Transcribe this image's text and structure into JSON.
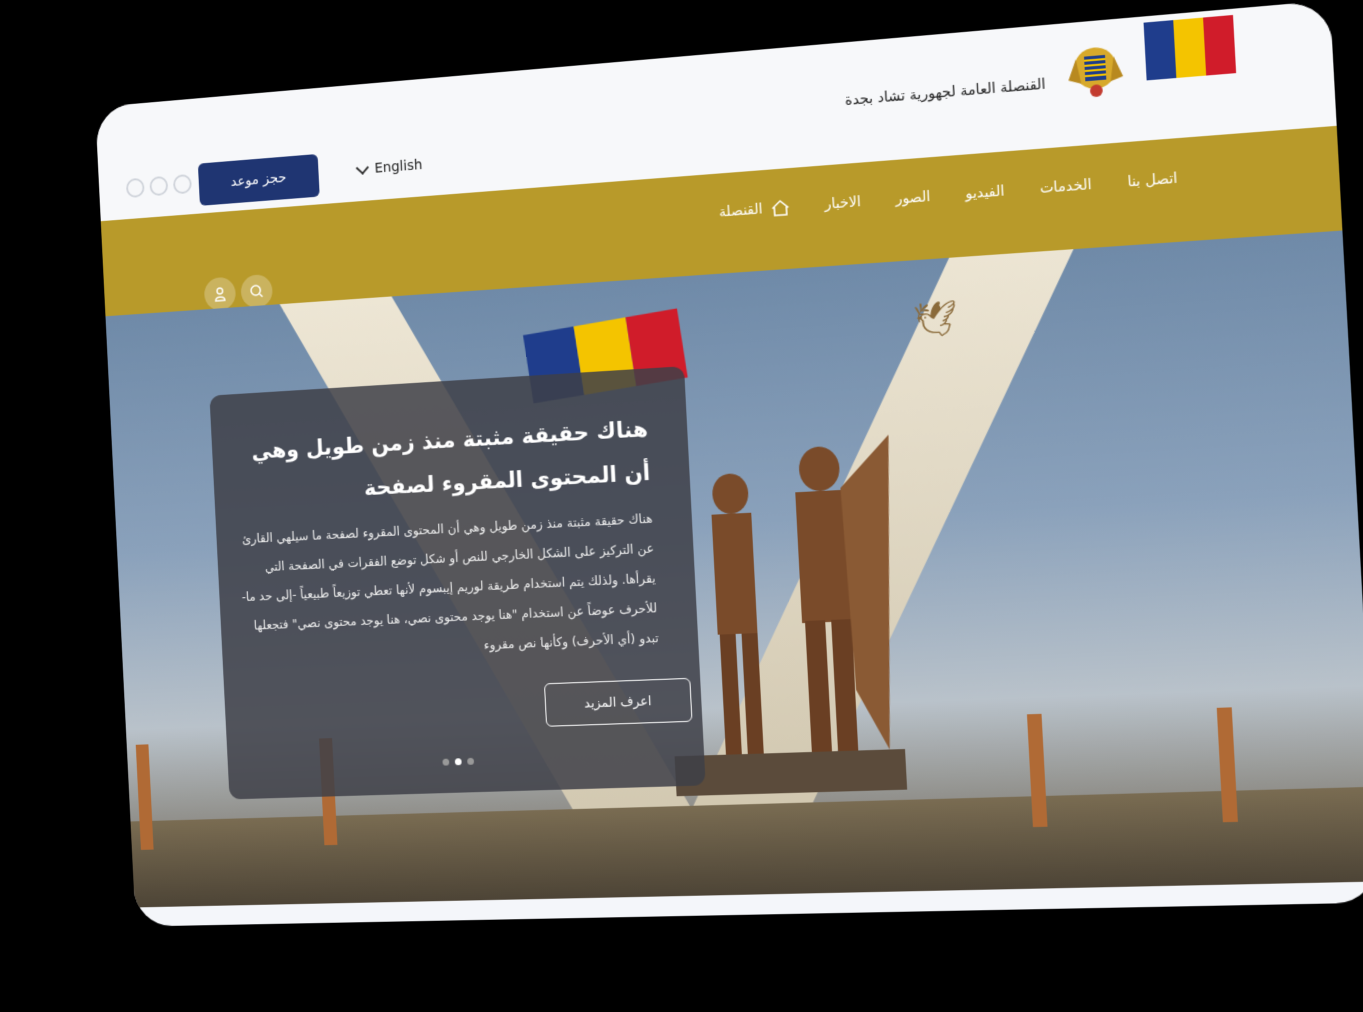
{
  "header": {
    "site_title": "القنصلة العامة لجهورية تشاد بجدة",
    "book_button": "حجز موعد",
    "language": "English"
  },
  "nav": {
    "items": [
      "القنصلة",
      "الاخبار",
      "الصور",
      "الفيديو",
      "الخدمات",
      "اتصل بنا"
    ]
  },
  "hero": {
    "title": "هناك حقيقة مثبتة منذ زمن طويل وهي أن المحتوى المقروء لصفحة",
    "body": "هناك حقيقة مثبتة منذ زمن طويل وهي أن المحتوى المقروء لصفحة ما سيلهي القارئ عن التركيز على الشكل الخارجي للنص أو شكل توضع الفقرات في الصفحة التي يقرأها. ولذلك يتم استخدام طريقة لوريم إيبسوم لأنها تعطي توزيعاً طبيعياً -إلى حد ما- للأحرف عوضاً عن استخدام \"هنا يوجد محتوى نصي، هنا يوجد محتوى نصي\" فتجعلها تبدو (أي الأحرف) وكأنها نص مقروء",
    "button": "اعرف المزيد"
  },
  "carousel": {
    "count": 3,
    "active": 2
  },
  "colors": {
    "brand_gold": "#b89a2a",
    "brand_blue": "#1f3572",
    "flag": [
      "#1f3d8c",
      "#f4c400",
      "#d01c2a"
    ]
  }
}
